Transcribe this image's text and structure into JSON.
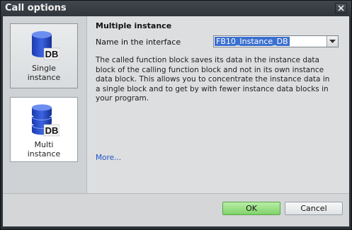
{
  "window": {
    "title": "Call options",
    "close_icon": "close-icon"
  },
  "options": [
    {
      "label_line1": "Single",
      "label_line2": "instance",
      "icon": "database-icon",
      "icon_text": "DB",
      "selected": true
    },
    {
      "label_line1": "Multi",
      "label_line2": "instance",
      "icon": "database-stack-icon",
      "icon_text": "DB",
      "selected": false
    }
  ],
  "detail": {
    "heading": "Multiple instance",
    "field_label": "Name in the interface",
    "field_value": "FB10_Instance_DB",
    "description": "The called function block saves its data in the instance data block of the calling function block and not in its own instance data block. This allows you to concentrate the instance data in a single block and to get by with fewer instance data blocks in your program.",
    "more_link": "More..."
  },
  "buttons": {
    "ok": "OK",
    "cancel": "Cancel"
  },
  "colors": {
    "accent_selection": "#3b6fd0",
    "ok_green": "#7fd26a",
    "db_blue": "#1d3fb5"
  }
}
